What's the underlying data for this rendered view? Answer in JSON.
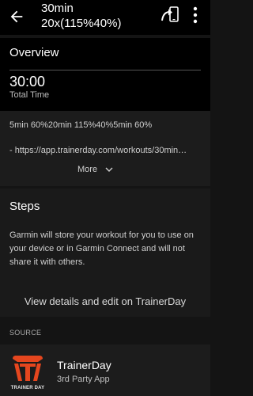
{
  "header": {
    "title_line1": "30min",
    "title_line2": "20x(115%40%)"
  },
  "overview": {
    "section_title": "Overview",
    "total_time_value": "30:00",
    "total_time_label": "Total Time",
    "description_line1": "5min 60%20min 115%40%5min 60%",
    "description_line2": " - https://app.trainerday.com/workouts/30min…",
    "more_label": "More"
  },
  "steps": {
    "section_title": "Steps",
    "notice": "Garmin will store your workout for you to use on your device or in Garmin Connect and will not share it with others.",
    "view_details_label": "View details and edit on TrainerDay"
  },
  "source": {
    "label": "SOURCE",
    "app_name": "TrainerDay",
    "app_type": "3rd Party App",
    "logo_text": "TRAINER DAY"
  },
  "colors": {
    "background": "#141414",
    "brand_accent": "#e5461e"
  }
}
